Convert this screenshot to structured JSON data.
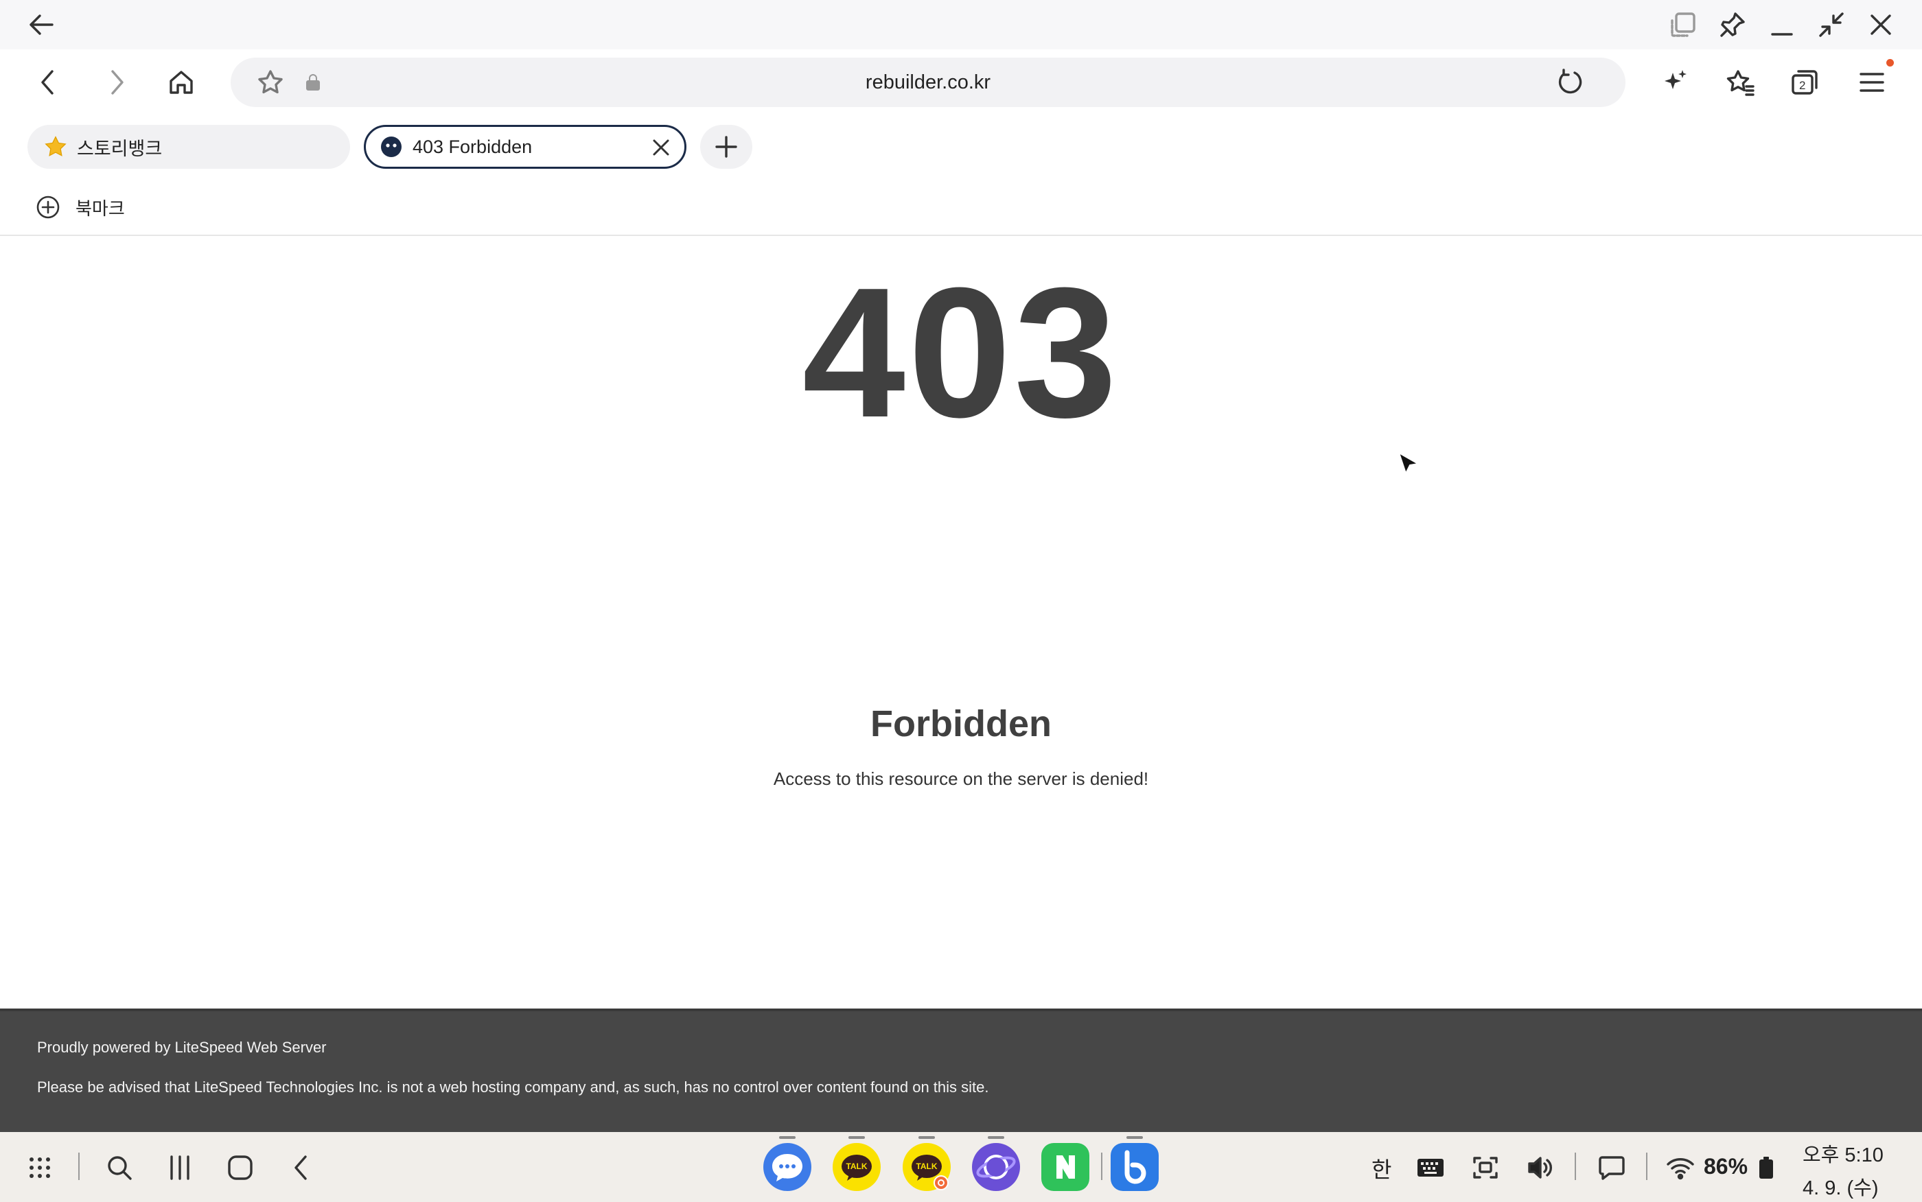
{
  "window": {
    "back_icon": "arrow-left-icon",
    "controls": [
      "multi-window-icon",
      "pin-icon",
      "minimize-icon",
      "restore-icon",
      "close-icon"
    ]
  },
  "toolbar": {
    "url": "rebuilder.co.kr",
    "tab_count": "2"
  },
  "tabs": [
    {
      "title": "스토리뱅크",
      "icon": "star-favicon"
    },
    {
      "title": "403 Forbidden",
      "icon": "site-favicon",
      "active": true
    }
  ],
  "bookmarks": {
    "add_label": "북마크"
  },
  "page": {
    "code": "403",
    "title": "Forbidden",
    "message": "Access to this resource on the server is denied!"
  },
  "footer": {
    "powered_by": "Proudly powered by LiteSpeed Web Server",
    "advisory": "Please be advised that LiteSpeed Technologies Inc. is not a web hosting company and, as such, has no control over content found on this site."
  },
  "taskbar": {
    "apps": [
      "Messages",
      "KakaoTalk",
      "KakaoTalk",
      "Samsung Internet",
      "Naver",
      "Bixby"
    ],
    "ime_label": "한",
    "battery": "86%",
    "time": "오후 5:10",
    "date": "4. 9. (수)",
    "colors": {
      "messages": "#3d7be8",
      "kakao": "#fae100",
      "internet": "#6a4fd6",
      "naver": "#2fc25a",
      "bixby": "#2c7be5"
    }
  }
}
